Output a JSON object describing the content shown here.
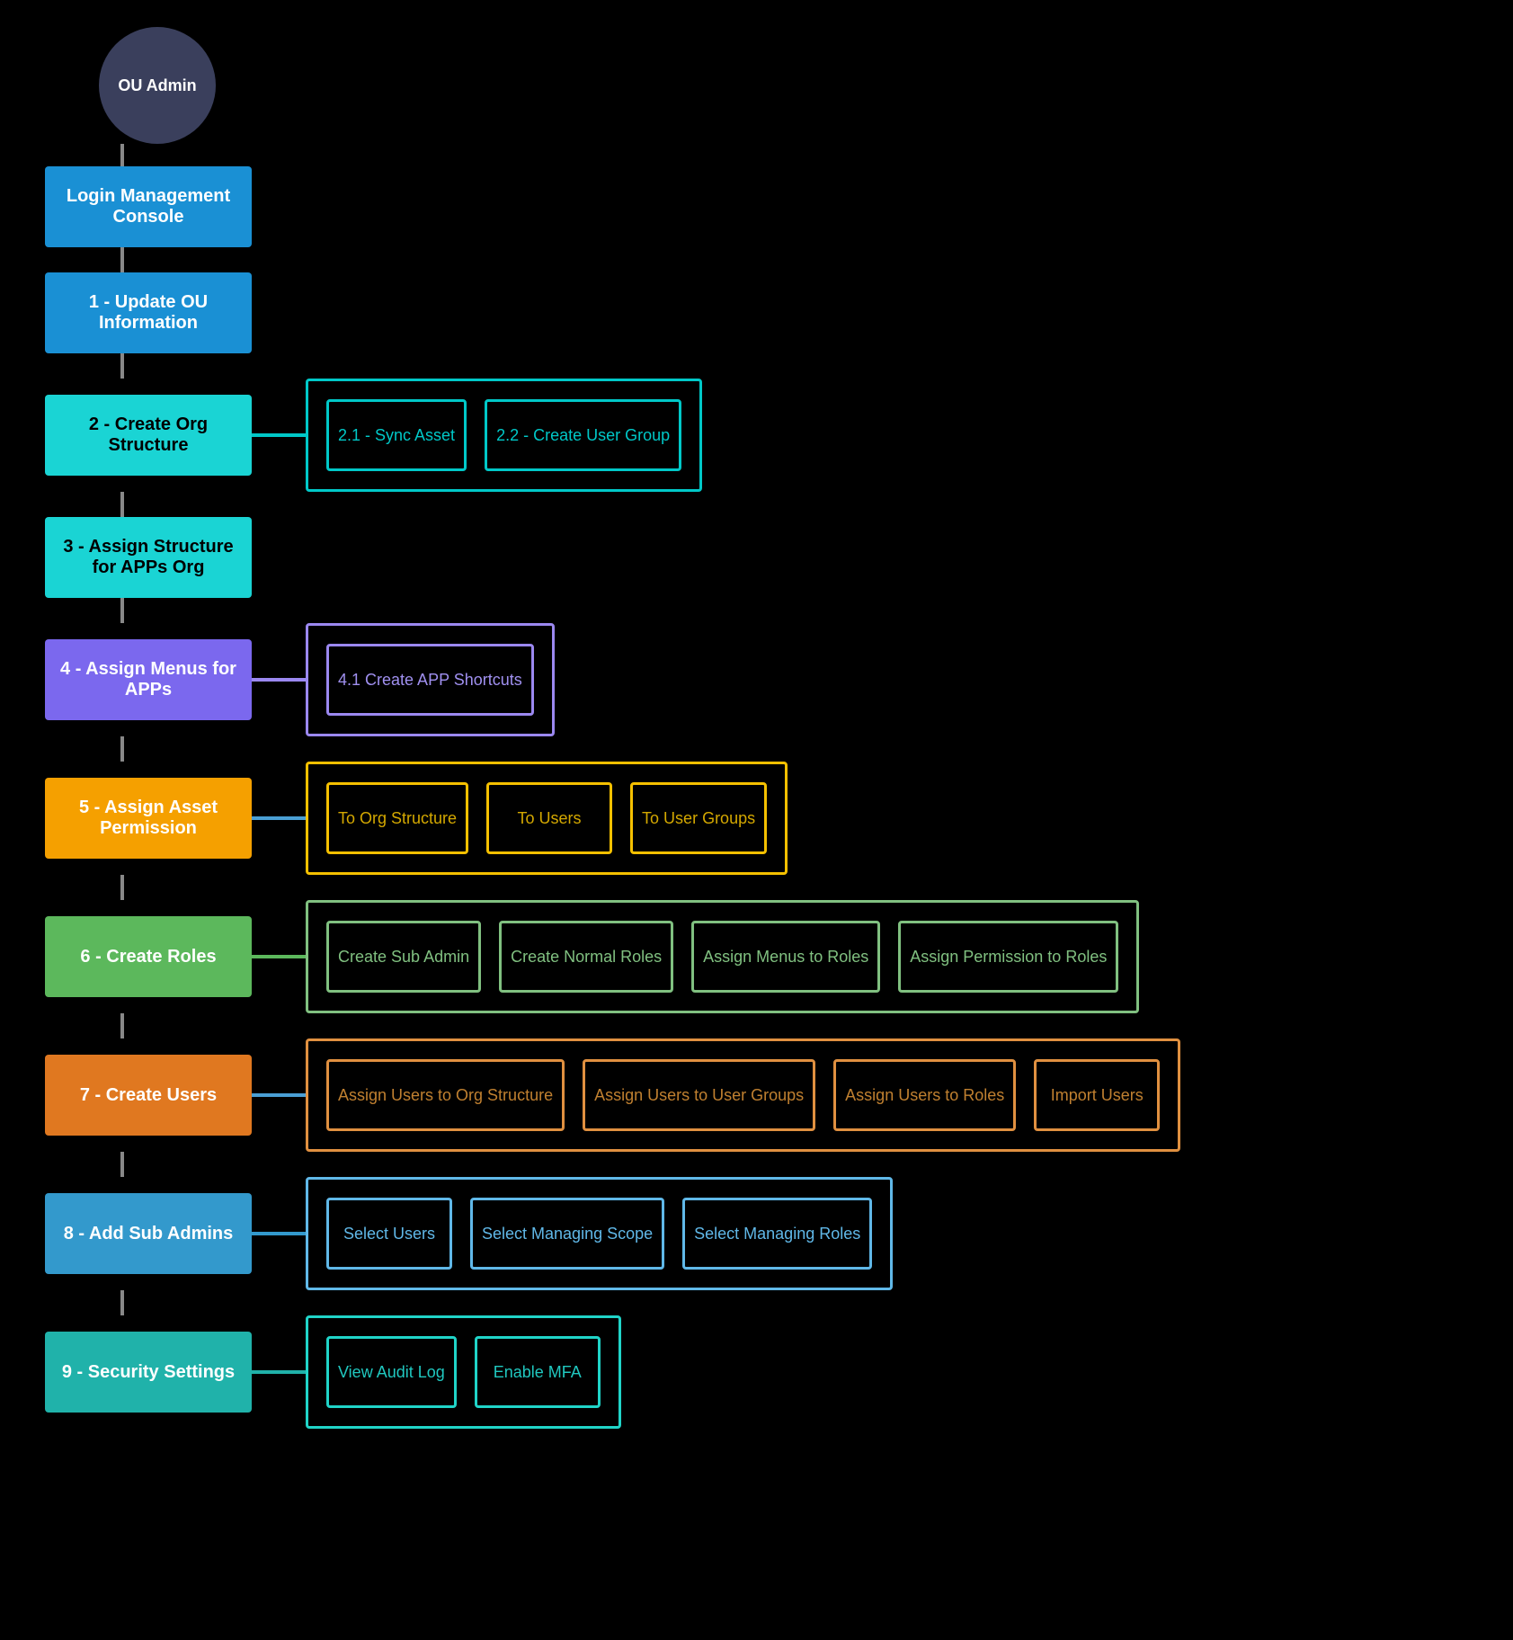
{
  "avatar": {
    "label": "OU Admin"
  },
  "steps": [
    {
      "id": "login",
      "label": "Login Management Console",
      "color_class": "blue-main",
      "has_sub": false,
      "sub_items": []
    },
    {
      "id": "step1",
      "label": "1 - Update OU Information",
      "color_class": "blue-main",
      "has_sub": false,
      "sub_items": []
    },
    {
      "id": "step2",
      "label": "2 - Create Org Structure",
      "color_class": "cyan-main",
      "has_sub": true,
      "container_color": "cyan-container",
      "h_line_color": "#4a9fd4",
      "sub_color": "cyan-sub",
      "sub_items": [
        {
          "label": "2.1 - Sync Asset"
        },
        {
          "label": "2.2 - Create User Group"
        }
      ]
    },
    {
      "id": "step3",
      "label": "3 - Assign Structure for APPs Org",
      "color_class": "cyan-main",
      "has_sub": false,
      "sub_items": []
    },
    {
      "id": "step4",
      "label": "4 - Assign Menus for APPs",
      "color_class": "purple-main",
      "has_sub": true,
      "container_color": "purple-container",
      "h_line_color": "#9b88f0",
      "sub_color": "purple-sub",
      "sub_items": [
        {
          "label": "4.1 Create APP Shortcuts"
        }
      ]
    },
    {
      "id": "step5",
      "label": "5 - Assign Asset Permission",
      "color_class": "yellow-main",
      "has_sub": true,
      "container_color": "yellow-container",
      "h_line_color": "#4a9fd4",
      "sub_color": "yellow-sub",
      "sub_items": [
        {
          "label": "To Org Structure"
        },
        {
          "label": "To Users"
        },
        {
          "label": "To User Groups"
        }
      ]
    },
    {
      "id": "step6",
      "label": "6 - Create Roles",
      "color_class": "green-main",
      "has_sub": true,
      "container_color": "green-container",
      "h_line_color": "#5cb85c",
      "sub_color": "green-sub",
      "sub_items": [
        {
          "label": "Create Sub Admin"
        },
        {
          "label": "Create Normal Roles"
        },
        {
          "label": "Assign Menus to Roles"
        },
        {
          "label": "Assign Permission to Roles"
        }
      ]
    },
    {
      "id": "step7",
      "label": "7 - Create Users",
      "color_class": "orange-main",
      "has_sub": true,
      "container_color": "orange-container",
      "h_line_color": "#e07820",
      "sub_color": "orange-sub",
      "sub_items": [
        {
          "label": "Assign Users to Org Structure"
        },
        {
          "label": "Assign Users to User Groups"
        },
        {
          "label": "Assign Users to Roles"
        },
        {
          "label": "Import Users"
        }
      ]
    },
    {
      "id": "step8",
      "label": "8 - Add Sub Admins",
      "color_class": "lightblue-main",
      "has_sub": true,
      "container_color": "lightblue-container",
      "h_line_color": "#3399cc",
      "sub_color": "lightblue-sub",
      "sub_items": [
        {
          "label": "Select Users"
        },
        {
          "label": "Select Managing Scope"
        },
        {
          "label": "Select Managing Roles"
        }
      ]
    },
    {
      "id": "step9",
      "label": "9 - Security Settings",
      "color_class": "teal-main",
      "has_sub": true,
      "container_color": "teal-container",
      "h_line_color": "#20b2aa",
      "sub_color": "teal-sub",
      "sub_items": [
        {
          "label": "View Audit Log"
        },
        {
          "label": "Enable MFA"
        }
      ]
    }
  ]
}
